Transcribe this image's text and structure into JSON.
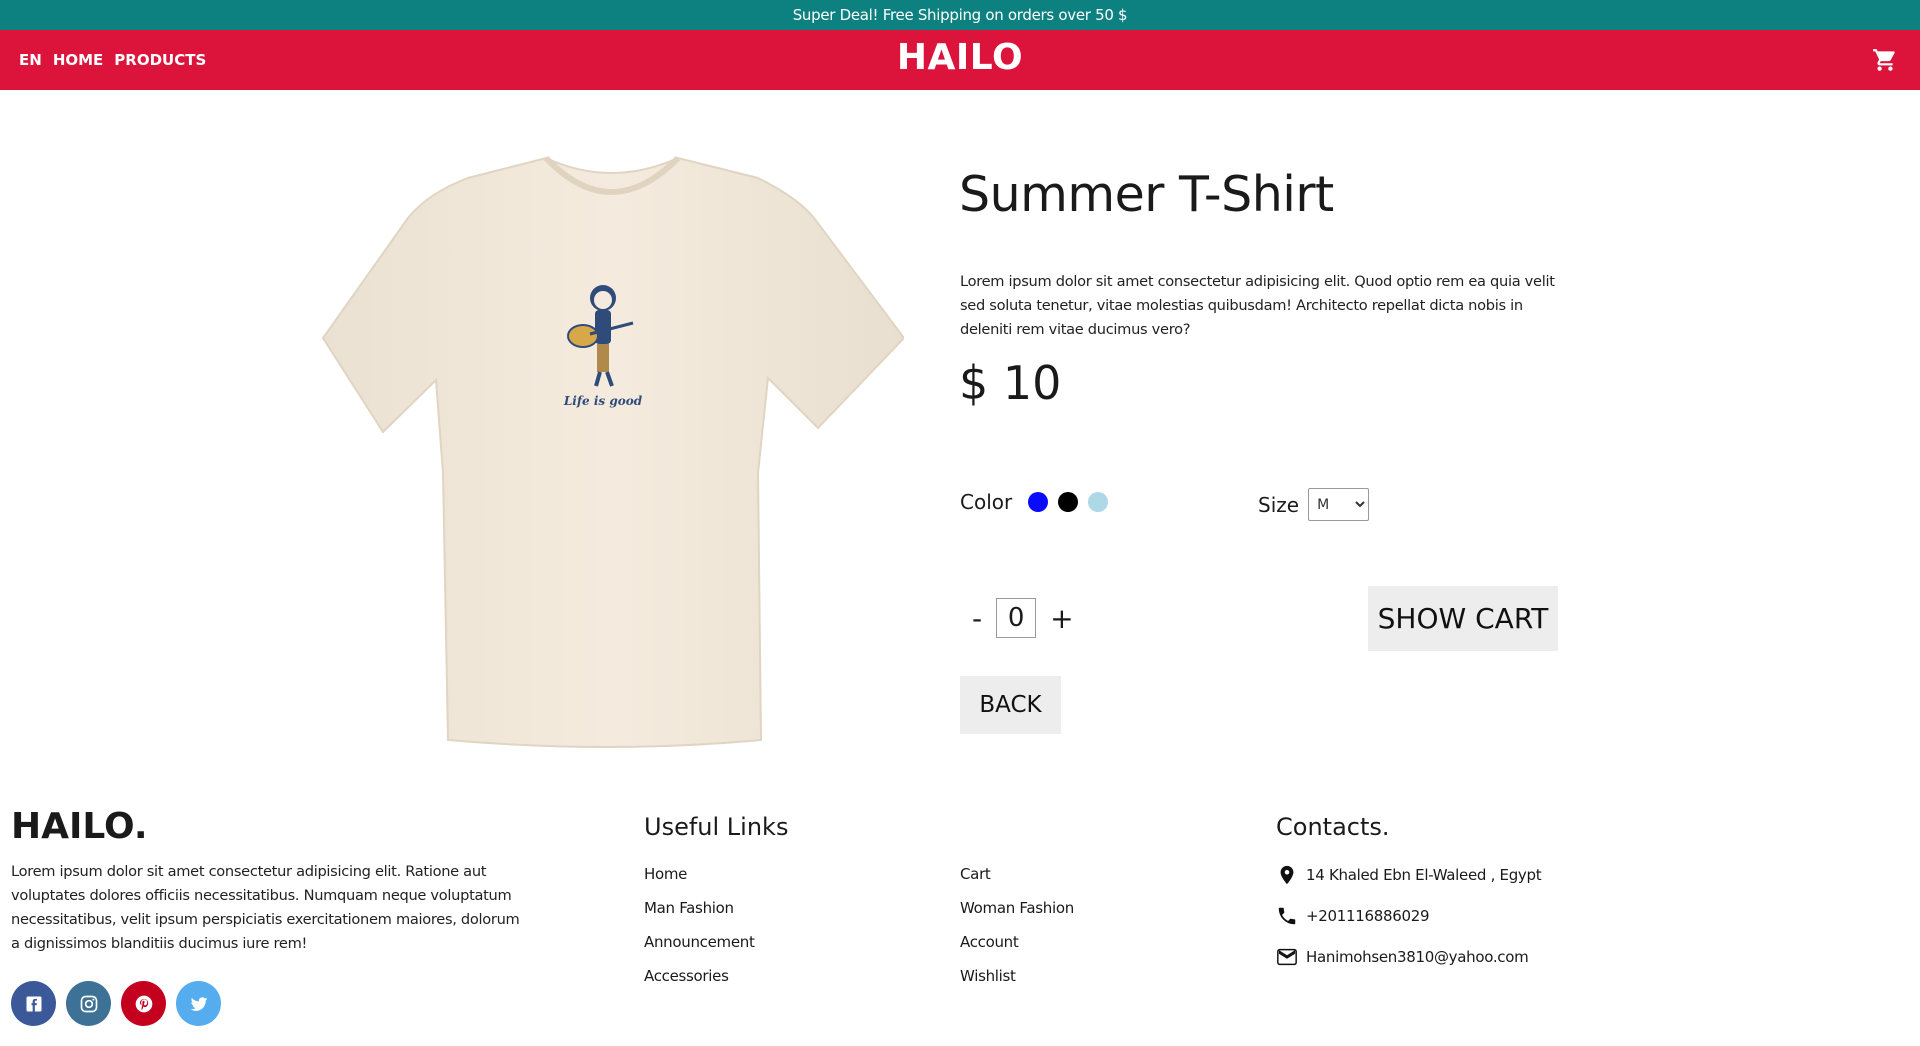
{
  "promo": {
    "text": "Super Deal! Free Shipping on orders over 50 $"
  },
  "nav": {
    "lang": "EN",
    "home": "HOME",
    "products": "PRODUCTS",
    "brand": "HAILO"
  },
  "product": {
    "title": "Summer T-Shirt",
    "description": "Lorem ipsum dolor sit amet consectetur adipisicing elit. Quod optio rem ea quia velit sed soluta tenetur, vitae molestias quibusdam! Architecto repellat dicta nobis in deleniti rem vitae ducimus vero?",
    "price": "$ 10",
    "image_text": "Life is good",
    "color_label": "Color",
    "colors": [
      "#0a0aff",
      "#000000",
      "#add8e6"
    ],
    "size_label": "Size",
    "size_value": "M",
    "quantity": "0",
    "minus": "-",
    "plus": "+",
    "show_cart": "SHOW CART",
    "back": "BACK"
  },
  "footer": {
    "brand": "HAILO.",
    "description": "Lorem ipsum dolor sit amet consectetur adipisicing elit. Ratione aut voluptates dolores officiis necessitatibus. Numquam neque voluptatum necessitatibus, velit ipsum perspiciatis exercitationem maiores, dolorum a dignissimos blanditiis ducimus iure rem!",
    "useful_links_title": "Useful Links",
    "links_col1": [
      "Home",
      "Man Fashion",
      "Announcement",
      "Accessories"
    ],
    "links_col2": [
      "Cart",
      "Woman Fashion",
      "Account",
      "Wishlist"
    ],
    "contacts_title": "Contacts.",
    "address": "14 Khaled Ebn El-Waleed , Egypt",
    "phone": "+201116886029",
    "email": "Hanimohsen3810@yahoo.com",
    "social": [
      {
        "name": "facebook-icon",
        "color": "#3b5999"
      },
      {
        "name": "instagram-icon",
        "color": "#3d7196"
      },
      {
        "name": "pinterest-icon",
        "color": "#c5001f"
      },
      {
        "name": "twitter-icon",
        "color": "#55acee"
      }
    ]
  },
  "theme": {
    "promo_bg": "#0d8080",
    "nav_bg": "#dc143c",
    "button_bg": "#ededed"
  }
}
